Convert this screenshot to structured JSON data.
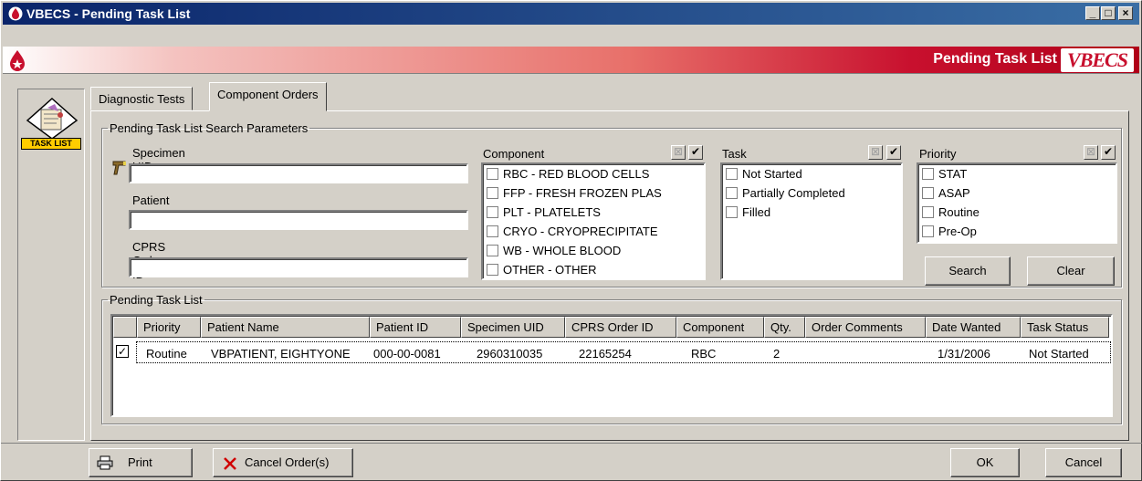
{
  "window": {
    "title": "VBECS - Pending Task List"
  },
  "banner": {
    "title": "Pending Task List",
    "logo_text": "VBECS"
  },
  "left_panel": {
    "label": "TASK LIST"
  },
  "tabs": [
    {
      "label": "Diagnostic Tests",
      "active": false
    },
    {
      "label": "Component Orders",
      "active": true
    }
  ],
  "search": {
    "legend": "Pending Task List Search Parameters",
    "specimen_uid_label": "Specimen UID",
    "specimen_uid_value": "",
    "patient_label": "Patient",
    "patient_value": "",
    "cprs_label": "CPRS Order ID",
    "cprs_value": "",
    "component_orders": {
      "label": "Component Orders",
      "items": [
        "RBC - RED BLOOD CELLS",
        "FFP - FRESH FROZEN PLAS",
        "PLT - PLATELETS",
        "CRYO - CRYOPRECIPITATE",
        "WB - WHOLE BLOOD",
        "OTHER - OTHER"
      ]
    },
    "task_status": {
      "label": "Task Status",
      "items": [
        "Not Started",
        "Partially Completed",
        "Filled"
      ]
    },
    "priority": {
      "label": "Priority",
      "items": [
        "STAT",
        "ASAP",
        "Routine",
        "Pre-Op"
      ]
    },
    "search_button": "Search",
    "clear_button": "Clear"
  },
  "results": {
    "legend": "Pending Task List",
    "columns": [
      "Priority",
      "Patient Name",
      "Patient ID",
      "Specimen UID",
      "CPRS Order ID",
      "Component",
      "Qty.",
      "Order Comments",
      "Date Wanted",
      "Task Status"
    ],
    "rows": [
      {
        "checked": true,
        "priority": "Routine",
        "patient_name": "VBPATIENT, EIGHTYONE",
        "patient_id": "000-00-0081",
        "specimen_uid": "2960310035",
        "cprs_order_id": "22165254",
        "component": "RBC",
        "qty": "2",
        "order_comments": "",
        "date_wanted": "1/31/2006",
        "task_status": "Not Started"
      }
    ]
  },
  "footer": {
    "print": "Print",
    "cancel_orders": "Cancel Order(s)",
    "ok": "OK",
    "cancel": "Cancel"
  },
  "colors": {
    "title_bar": "#0a246a",
    "banner_red": "#c8102e",
    "face": "#d4d0c8"
  }
}
